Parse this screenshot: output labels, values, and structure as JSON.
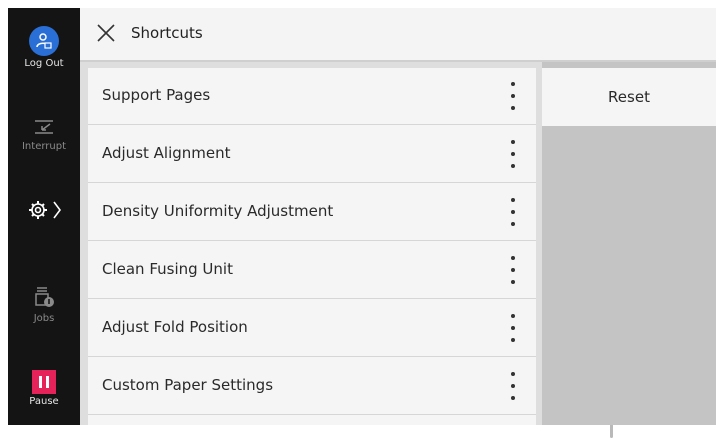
{
  "sidebar": {
    "logout_label": "Log Out",
    "interrupt_label": "Interrupt",
    "jobs_label": "Jobs",
    "pause_label": "Pause"
  },
  "header": {
    "title": "Shortcuts"
  },
  "list": {
    "items": [
      {
        "label": "Support Pages"
      },
      {
        "label": "Adjust Alignment"
      },
      {
        "label": "Density Uniformity Adjustment"
      },
      {
        "label": "Clean Fusing Unit"
      },
      {
        "label": "Adjust Fold Position"
      },
      {
        "label": "Custom Paper Settings"
      }
    ]
  },
  "actions": {
    "reset_label": "Reset"
  },
  "colors": {
    "logout_accent": "#2a6fd6",
    "pause_accent": "#e5235a"
  }
}
